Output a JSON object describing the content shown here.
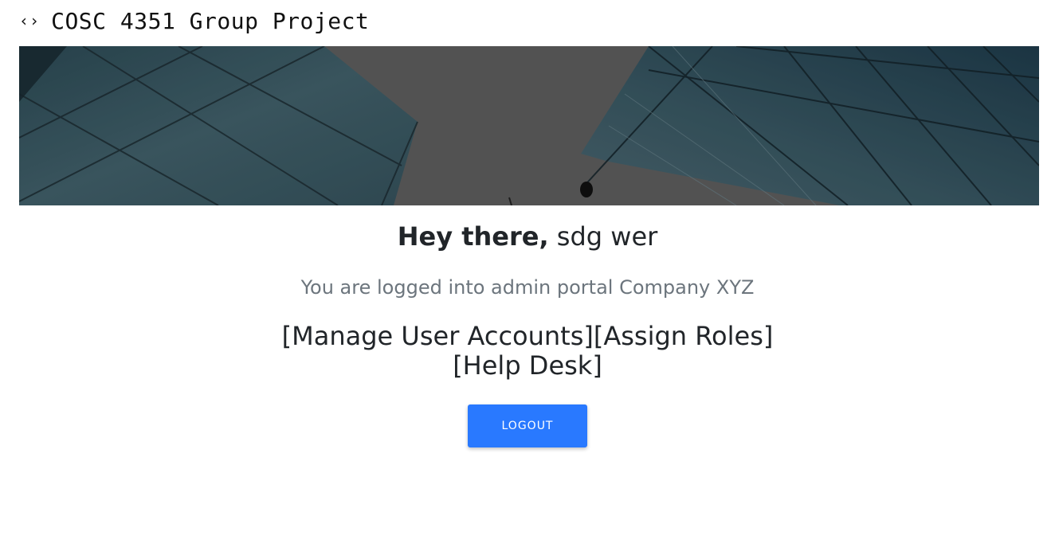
{
  "header": {
    "icon": "code-icon",
    "icon_glyph": "‹›",
    "title": "COSC 4351 Group Project"
  },
  "hero": {
    "image": "glass-skyscrapers-looking-up"
  },
  "greeting": {
    "prefix": "Hey there,",
    "name": "sdg wer"
  },
  "subtitle": "You are logged into admin portal Company XYZ",
  "links": {
    "items": [
      "[Manage User Accounts]",
      "[Assign Roles]",
      "[Help Desk]"
    ]
  },
  "logout": {
    "label": "LOGOUT"
  },
  "colors": {
    "accent": "#2979ff",
    "muted_text": "#6c757d",
    "hero_overlay": "#5c5c5c"
  }
}
